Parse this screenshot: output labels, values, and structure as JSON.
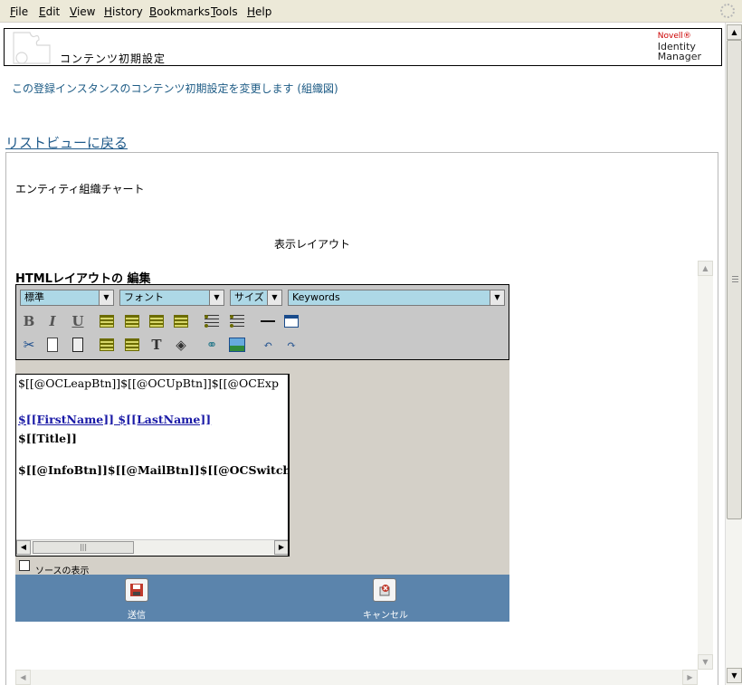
{
  "menu": [
    "File",
    "Edit",
    "View",
    "History",
    "Bookmarks",
    "Tools",
    "Help"
  ],
  "header": {
    "title": "コンテンツ初期設定",
    "brand_line1": "Novell",
    "brand_reg": "®",
    "brand_line2": "Identity",
    "brand_line3": "Manager"
  },
  "description": "この登録インスタンスのコンテンツ初期設定を変更します (組織図)",
  "back_link": "リストビューに戻る",
  "entity_label": "エンティティ組織チャート",
  "layout_caption": "表示レイアウト",
  "edit_title": "HTMLレイアウトの 編集",
  "toolbar": {
    "format_select": "標準",
    "font_select": "フォント",
    "size_select": "サイズ",
    "keywords_select": "Keywords"
  },
  "editor_content": {
    "line1": "$[[@OCLeapBtn]]$[[@OCUpBtn]]$[[@OCExp",
    "line2": "$[[FirstName]] $[[LastName]]",
    "line3": "$[[Title]]",
    "line4": "$[[@InfoBtn]]$[[@MailBtn]]$[[@OCSwitchB"
  },
  "source_label": "ソースの表示",
  "source_checked": false,
  "actions": {
    "submit_label": "送信",
    "cancel_label": "キャンセル"
  }
}
